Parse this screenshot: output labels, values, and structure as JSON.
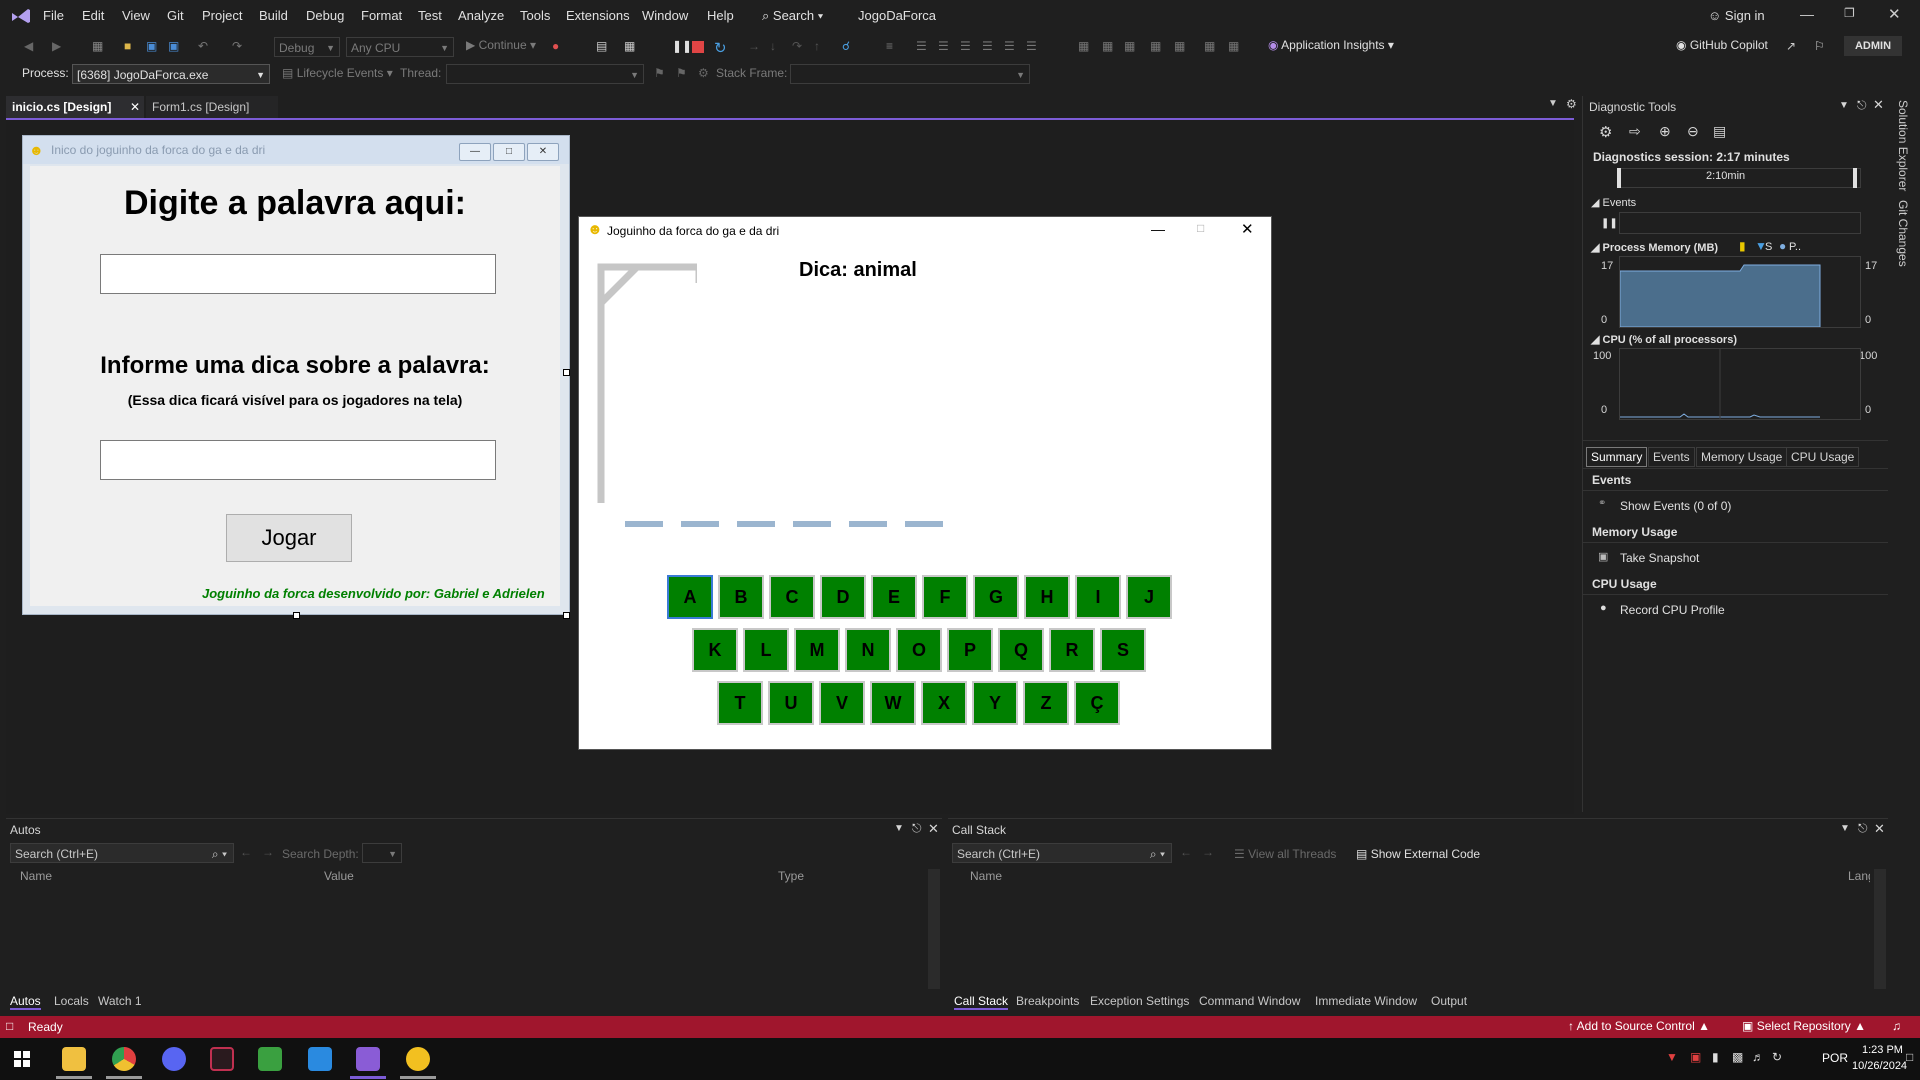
{
  "menubar": {
    "items": [
      "File",
      "Edit",
      "View",
      "Git",
      "Project",
      "Build",
      "Debug",
      "Format",
      "Test",
      "Analyze",
      "Tools",
      "Extensions",
      "Window",
      "Help"
    ],
    "search_label": "Search",
    "project_name": "JogoDaForca",
    "signin": "Sign in"
  },
  "toolbar": {
    "config": "Debug",
    "platform": "Any CPU",
    "continue_label": "Continue",
    "app_insights": "Application Insights",
    "copilot": "GitHub Copilot",
    "admin": "ADMIN"
  },
  "procbar": {
    "process_label": "Process:",
    "process_value": "[6368] JogoDaForca.exe",
    "lifecycle": "Lifecycle Events",
    "thread_label": "Thread:",
    "stack_frame_label": "Stack Frame:"
  },
  "doctabs": {
    "tab1": "inicio.cs [Design]",
    "tab2": "Form1.cs [Design]"
  },
  "inicio_form": {
    "title": "Inico do joguinho da forca do ga e da dri",
    "heading": "Digite a palavra aqui:",
    "hint_heading": "Informe uma dica sobre a palavra:",
    "hint_note": "(Essa dica ficará visível para os jogadores na tela)",
    "play_button": "Jogar",
    "credits": "Joguinho da forca desenvolvido por: Gabriel e Adrielen"
  },
  "forca_form": {
    "title": "Joguinho da forca do ga e da dri",
    "hint": "Dica: animal",
    "word_length": 6,
    "row1": [
      "A",
      "B",
      "C",
      "D",
      "E",
      "F",
      "G",
      "H",
      "I",
      "J"
    ],
    "row2": [
      "K",
      "L",
      "M",
      "N",
      "O",
      "P",
      "Q",
      "R",
      "S"
    ],
    "row3": [
      "T",
      "U",
      "V",
      "W",
      "X",
      "Y",
      "Z",
      "Ç"
    ]
  },
  "diagnostics": {
    "title": "Diagnostic Tools",
    "session": "Diagnostics session: 2:17 minutes",
    "timeline_label": "2:10min",
    "events_label": "Events",
    "memory_label": "Process Memory (MB)",
    "memory_legend_s": "S",
    "memory_legend_p": "P..",
    "memory_max": "17",
    "memory_min": "0",
    "cpu_label": "CPU (% of all processors)",
    "cpu_max": "100",
    "cpu_min": "0",
    "tabs": [
      "Summary",
      "Events",
      "Memory Usage",
      "CPU Usage"
    ],
    "sec_events": "Events",
    "show_events": "Show Events (0 of 0)",
    "sec_memory": "Memory Usage",
    "take_snapshot": "Take Snapshot",
    "sec_cpu": "CPU Usage",
    "record_cpu": "Record CPU Profile"
  },
  "side_strip": {
    "solution_explorer": "Solution Explorer",
    "git_changes": "Git Changes"
  },
  "autos": {
    "title": "Autos",
    "search": "Search (Ctrl+E)",
    "search_depth": "Search Depth:",
    "col_name": "Name",
    "col_value": "Value",
    "col_type": "Type",
    "tabs": [
      "Autos",
      "Locals",
      "Watch 1"
    ]
  },
  "callstack": {
    "title": "Call Stack",
    "search": "Search (Ctrl+E)",
    "view_threads": "View all Threads",
    "show_external": "Show External Code",
    "col_name": "Name",
    "col_lang": "Lang",
    "tabs": [
      "Call Stack",
      "Breakpoints",
      "Exception Settings",
      "Command Window",
      "Immediate Window",
      "Output"
    ]
  },
  "statusbar": {
    "ready": "Ready",
    "source_control": "Add to Source Control",
    "repository": "Select Repository"
  },
  "taskbar": {
    "lang": "POR",
    "time": "1:23 PM",
    "date": "10/26/2024"
  }
}
